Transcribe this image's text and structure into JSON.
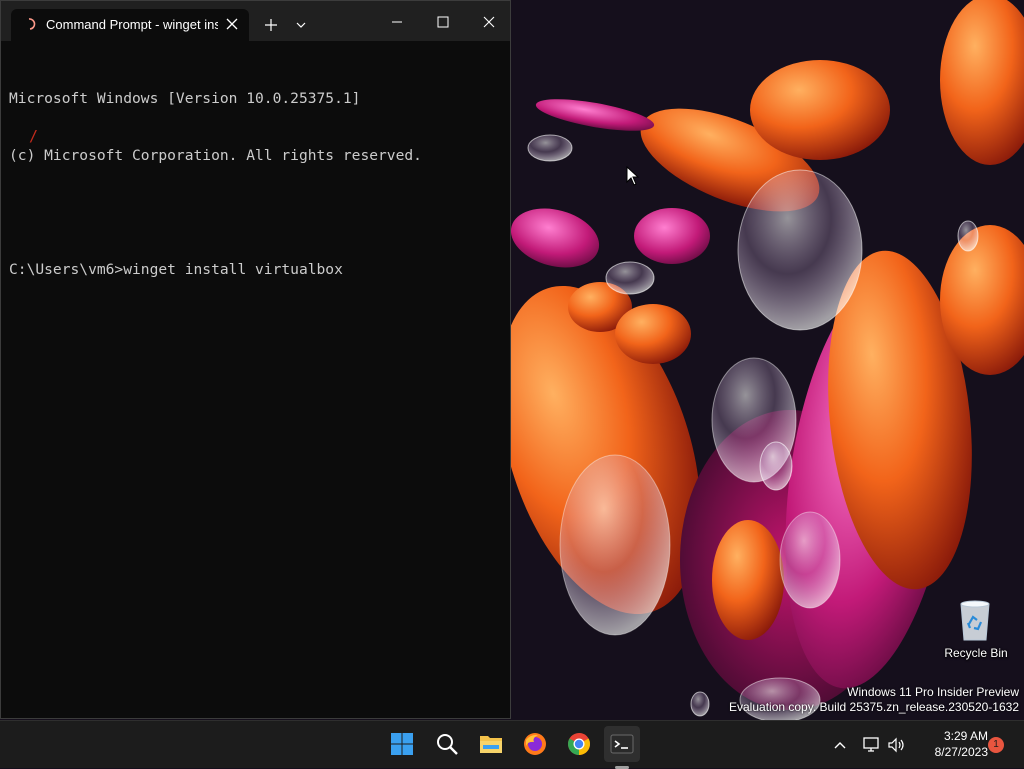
{
  "window": {
    "tab_title": "Command Prompt - winget install virtualbox",
    "new_tab_icon": "plus-icon",
    "dropdown_icon": "chevron-down-icon",
    "minimize_icon": "minimize-icon",
    "maximize_icon": "maximize-icon",
    "close_icon": "close-icon"
  },
  "console": {
    "lines": [
      "Microsoft Windows [Version 10.0.25375.1]",
      "(c) Microsoft Corporation. All rights reserved.",
      "",
      "C:\\Users\\vm6>winget install virtualbox"
    ],
    "progress_glyph": "/"
  },
  "desktop": {
    "recycle_bin_label": "Recycle Bin",
    "watermark_line1": "Windows 11 Pro Insider Preview",
    "watermark_line2": "Evaluation copy. Build 25375.zn_release.230520-1632"
  },
  "taskbar": {
    "apps": [
      {
        "name": "Start",
        "icon": "windows-logo-icon"
      },
      {
        "name": "Search",
        "icon": "search-icon"
      },
      {
        "name": "File Explorer",
        "icon": "folder-icon"
      },
      {
        "name": "Firefox",
        "icon": "firefox-icon"
      },
      {
        "name": "Chrome",
        "icon": "chrome-icon"
      },
      {
        "name": "Terminal",
        "icon": "terminal-icon",
        "active": true
      }
    ],
    "time": "3:29 AM",
    "date": "8/27/2023",
    "notification_count": "1"
  },
  "colors": {
    "terminal_bg": "#0c0c0c",
    "titlebar_bg": "#202020",
    "taskbar_bg": "#1c1c1c",
    "accent_red": "#c42b1c",
    "notification_badge": "#e8553f"
  }
}
